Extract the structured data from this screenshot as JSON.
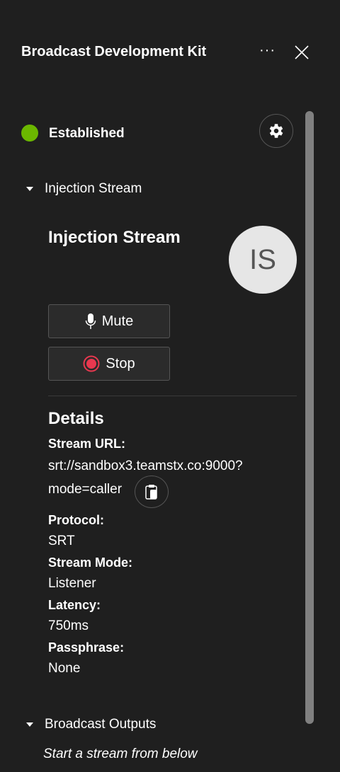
{
  "header": {
    "title": "Broadcast Development Kit",
    "more": "···"
  },
  "status": {
    "text": "Established",
    "color": "#6bb700"
  },
  "injection": {
    "section_label": "Injection Stream",
    "title": "Injection Stream",
    "avatar": "IS",
    "mute": "Mute",
    "stop": "Stop"
  },
  "details": {
    "heading": "Details",
    "stream_url_label": "Stream URL:",
    "stream_url_1": "srt://sandbox3.teamstx.co:9000?",
    "stream_url_2": "mode=caller",
    "protocol_label": "Protocol:",
    "protocol": "SRT",
    "mode_label": "Stream Mode:",
    "mode": "Listener",
    "latency_label": "Latency:",
    "latency": "750ms",
    "pass_label": "Passphrase:",
    "pass": "None"
  },
  "outputs": {
    "section_label": "Broadcast Outputs",
    "hint": "Start a stream from below"
  }
}
